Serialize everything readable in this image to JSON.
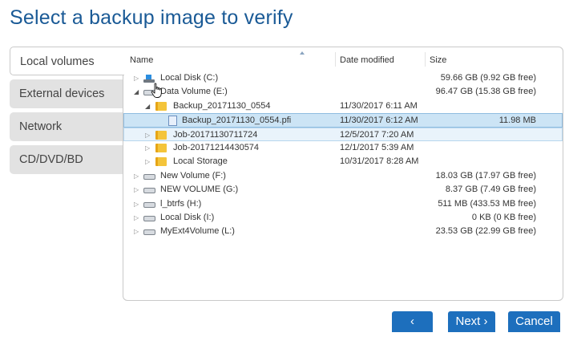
{
  "title": "Select a backup image to verify",
  "tabs": [
    {
      "label": "Local volumes"
    },
    {
      "label": "External devices"
    },
    {
      "label": "Network"
    },
    {
      "label": "CD/DVD/BD"
    }
  ],
  "columns": {
    "name": "Name",
    "date": "Date modified",
    "size": "Size"
  },
  "rows": [
    {
      "name": "Local Disk (C:)",
      "date": "",
      "size": "59.66 GB (9.92 GB free)"
    },
    {
      "name": "Data Volume (E:)",
      "date": "",
      "size": "96.47 GB (15.38 GB free)"
    },
    {
      "name": "Backup_20171130_0554",
      "date": "11/30/2017 6:11 AM",
      "size": ""
    },
    {
      "name": "Backup_20171130_0554.pfi",
      "date": "11/30/2017 6:12 AM",
      "size": "11.98 MB"
    },
    {
      "name": "Job-20171130711724",
      "date": "12/5/2017 7:20 AM",
      "size": ""
    },
    {
      "name": "Job-20171214430574",
      "date": "12/1/2017 5:39 AM",
      "size": ""
    },
    {
      "name": "Local Storage",
      "date": "10/31/2017 8:28 AM",
      "size": ""
    },
    {
      "name": "New Volume (F:)",
      "date": "",
      "size": "18.03 GB (17.97 GB free)"
    },
    {
      "name": "NEW VOLUME (G:)",
      "date": "",
      "size": "8.37 GB (7.49 GB free)"
    },
    {
      "name": "l_btrfs (H:)",
      "date": "",
      "size": "511 MB (433.53 MB free)"
    },
    {
      "name": "Local Disk (I:)",
      "date": "",
      "size": "0 KB (0 KB free)"
    },
    {
      "name": "MyExt4Volume (L:)",
      "date": "",
      "size": "23.53 GB (22.99 GB free)"
    }
  ],
  "buttons": {
    "back": "‹ Back",
    "next": "Next ›",
    "cancel": "Cancel"
  },
  "colors": {
    "accent": "#1d6fbd",
    "title": "#1a5a96",
    "selection": "#cce4f5"
  }
}
